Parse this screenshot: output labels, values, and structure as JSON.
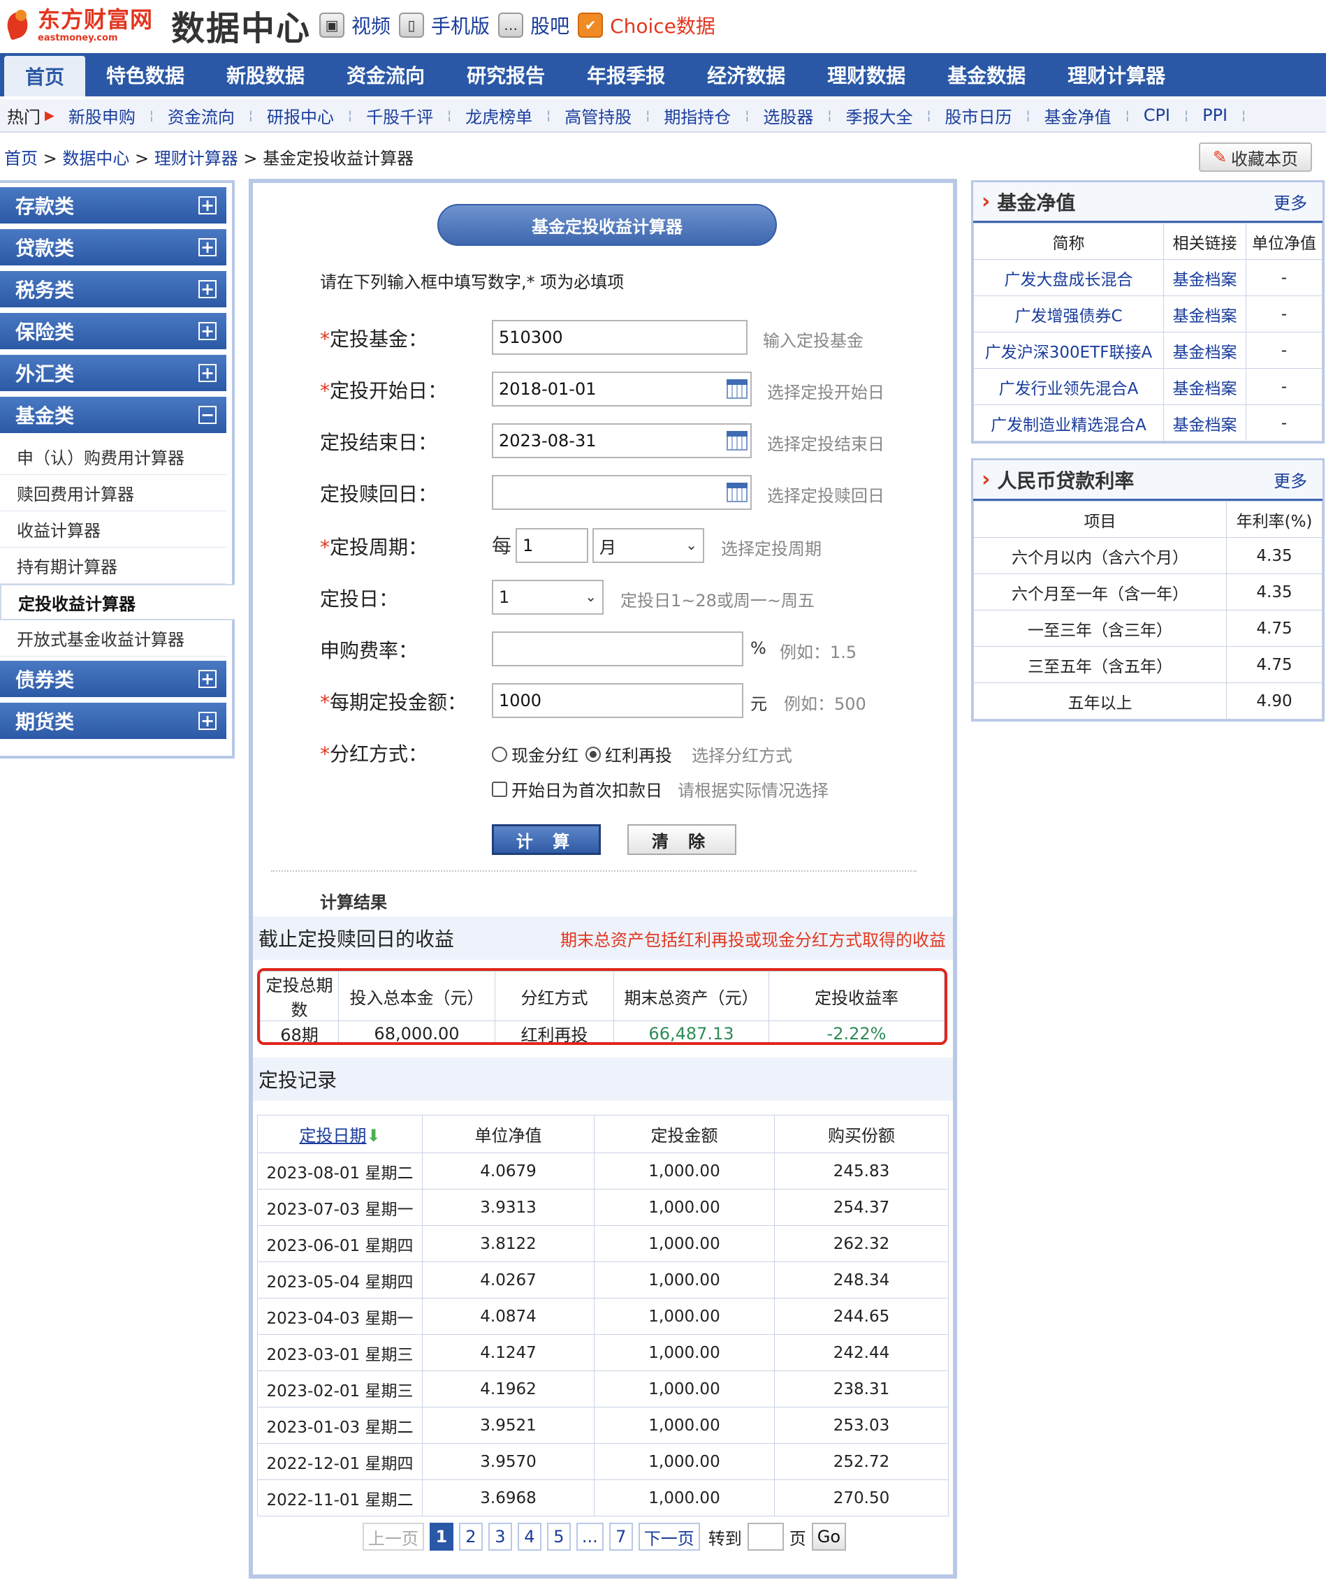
{
  "header": {
    "logo_cn": "东方财富网",
    "logo_en": "eastmoney.com",
    "site_title": "数据中心",
    "links": [
      {
        "label": "视频",
        "icon": "video-icon"
      },
      {
        "label": "手机版",
        "icon": "phone-icon"
      },
      {
        "label": "股吧",
        "icon": "chat-icon"
      },
      {
        "label": "Choice数据",
        "icon": "checkmark-icon"
      }
    ]
  },
  "main_nav": [
    "首页",
    "特色数据",
    "新股数据",
    "资金流向",
    "研究报告",
    "年报季报",
    "经济数据",
    "理财数据",
    "基金数据",
    "理财计算器"
  ],
  "sub_nav": {
    "hot_label": "热门",
    "items": [
      "新股申购",
      "资金流向",
      "研报中心",
      "千股千评",
      "龙虎榜单",
      "高管持股",
      "期指持仓",
      "选股器",
      "季报大全",
      "股市日历",
      "基金净值",
      "CPI",
      "PPI"
    ]
  },
  "breadcrumb": {
    "items": [
      "首页",
      "数据中心",
      "理财计算器"
    ],
    "current": "基金定投收益计算器",
    "separator": ">"
  },
  "bookmark_label": "收藏本页",
  "sidebar": {
    "categories_top": [
      {
        "label": "存款类",
        "toggle": "+"
      },
      {
        "label": "贷款类",
        "toggle": "+"
      },
      {
        "label": "税务类",
        "toggle": "+"
      },
      {
        "label": "保险类",
        "toggle": "+"
      },
      {
        "label": "外汇类",
        "toggle": "+"
      },
      {
        "label": "基金类",
        "toggle": "−"
      }
    ],
    "fund_items": [
      "申（认）购费用计算器",
      "赎回费用计算器",
      "收益计算器",
      "持有期计算器",
      "定投收益计算器",
      "开放式基金收益计算器"
    ],
    "categories_bottom": [
      {
        "label": "债券类",
        "toggle": "+"
      },
      {
        "label": "期货类",
        "toggle": "+"
      }
    ]
  },
  "calculator": {
    "title": "基金定投收益计算器",
    "intro": "请在下列输入框中填写数字,* 项为必填项",
    "fund": {
      "label": "定投基金：",
      "value": "510300",
      "hint": "输入定投基金"
    },
    "start_date": {
      "label": "定投开始日：",
      "value": "2018-01-01",
      "hint": "选择定投开始日"
    },
    "end_date": {
      "label": "定投结束日：",
      "value": "2023-08-31",
      "hint": "选择定投结束日"
    },
    "redeem_date": {
      "label": "定投赎回日：",
      "value": "",
      "hint": "选择定投赎回日"
    },
    "period": {
      "label": "定投周期：",
      "prefix": "每",
      "value": "1",
      "unit": "月",
      "hint": "选择定投周期"
    },
    "invest_day": {
      "label": "定投日：",
      "value": "1",
      "hint": "定投日1~28或周一~周五"
    },
    "fee_rate": {
      "label": "申购费率：",
      "value": "",
      "unit": "%",
      "hint": "例如：1.5"
    },
    "amount": {
      "label": "每期定投金额：",
      "value": "1000",
      "unit": "元",
      "hint": "例如：500"
    },
    "dividend": {
      "label": "分红方式：",
      "option_cash": "现金分红",
      "option_reinvest": "红利再投",
      "selected": "红利再投",
      "hint": "选择分红方式"
    },
    "first_deduct": {
      "label": "开始日为首次扣款日",
      "checked": false,
      "hint": "请根据实际情况选择"
    },
    "required_mark": "*",
    "calc_button": "计 算",
    "clear_button": "清 除"
  },
  "results": {
    "heading": "计算结果",
    "summary_title": "截止定投赎回日的收益",
    "summary_note": "期末总资产包括红利再投或现金分红方式取得的收益",
    "summary_headers": [
      "定投总期数",
      "投入总本金（元）",
      "分红方式",
      "期末总资产（元）",
      "定投收益率"
    ],
    "summary_values": [
      "68期",
      "68,000.00",
      "红利再投",
      "66,487.13",
      "-2.22%"
    ],
    "records_title": "定投记录",
    "records_headers": [
      "定投日期",
      "单位净值",
      "定投金额",
      "购买份额"
    ],
    "records": [
      [
        "2023-08-01 星期二",
        "4.0679",
        "1,000.00",
        "245.83"
      ],
      [
        "2023-07-03 星期一",
        "3.9313",
        "1,000.00",
        "254.37"
      ],
      [
        "2023-06-01 星期四",
        "3.8122",
        "1,000.00",
        "262.32"
      ],
      [
        "2023-05-04 星期四",
        "4.0267",
        "1,000.00",
        "248.34"
      ],
      [
        "2023-04-03 星期一",
        "4.0874",
        "1,000.00",
        "244.65"
      ],
      [
        "2023-03-01 星期三",
        "4.1247",
        "1,000.00",
        "242.44"
      ],
      [
        "2023-02-01 星期三",
        "4.1962",
        "1,000.00",
        "238.31"
      ],
      [
        "2023-01-03 星期二",
        "3.9521",
        "1,000.00",
        "253.03"
      ],
      [
        "2022-12-01 星期四",
        "3.9570",
        "1,000.00",
        "252.72"
      ],
      [
        "2022-11-01 星期二",
        "3.6968",
        "1,000.00",
        "270.50"
      ]
    ]
  },
  "pager": {
    "prev": "上一页",
    "pages": [
      "1",
      "2",
      "3",
      "4",
      "5"
    ],
    "ellipsis": "...",
    "last": "7",
    "next": "下一页",
    "goto_label": "转到",
    "page_suffix": "页",
    "go": "Go",
    "current": "1"
  },
  "fund_nav_panel": {
    "title": "基金净值",
    "more": "更多",
    "headers": [
      "简称",
      "相关链接",
      "单位净值"
    ],
    "rows": [
      [
        "广发大盘成长混合",
        "基金档案",
        "-"
      ],
      [
        "广发增强债券C",
        "基金档案",
        "-"
      ],
      [
        "广发沪深300ETF联接A",
        "基金档案",
        "-"
      ],
      [
        "广发行业领先混合A",
        "基金档案",
        "-"
      ],
      [
        "广发制造业精选混合A",
        "基金档案",
        "-"
      ]
    ]
  },
  "loan_rate_panel": {
    "title": "人民币贷款利率",
    "more": "更多",
    "headers": [
      "项目",
      "年利率(%)"
    ],
    "rows": [
      [
        "六个月以内（含六个月）",
        "4.35"
      ],
      [
        "六个月至一年（含一年）",
        "4.35"
      ],
      [
        "一至三年（含三年）",
        "4.75"
      ],
      [
        "三至五年（含五年）",
        "4.75"
      ],
      [
        "五年以上",
        "4.90"
      ]
    ]
  },
  "colors": {
    "nav_blue": "#2a58a6",
    "brand_red": "#e2361f",
    "positive_green": "#2e8b57",
    "highlight_border": "#e0261b"
  }
}
